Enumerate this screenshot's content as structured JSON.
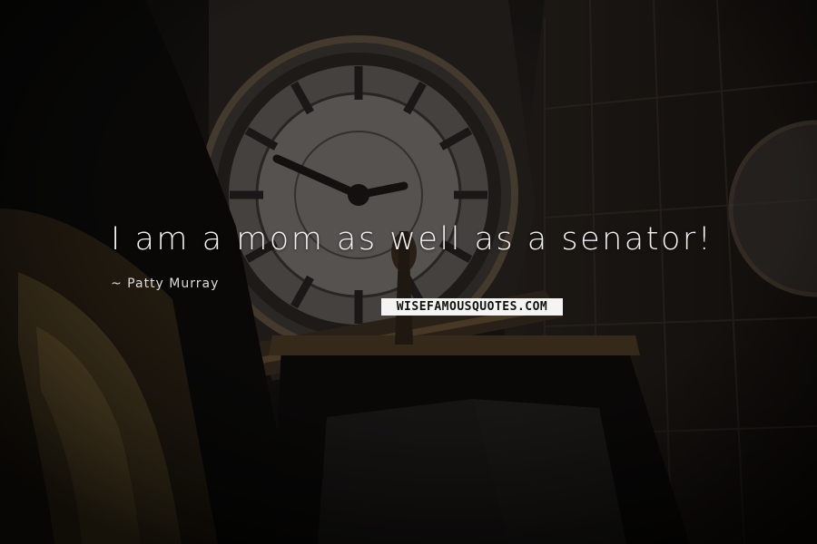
{
  "quote": {
    "text": "I am a mom as well as a senator!",
    "author": "~ Patty Murray"
  },
  "logo": {
    "text": "WISEFAMOUSQUOTES.COM"
  },
  "background": {
    "subject-icon": "clock-tower-icon",
    "tint": "#1a1613",
    "accent": "#c9b088"
  }
}
